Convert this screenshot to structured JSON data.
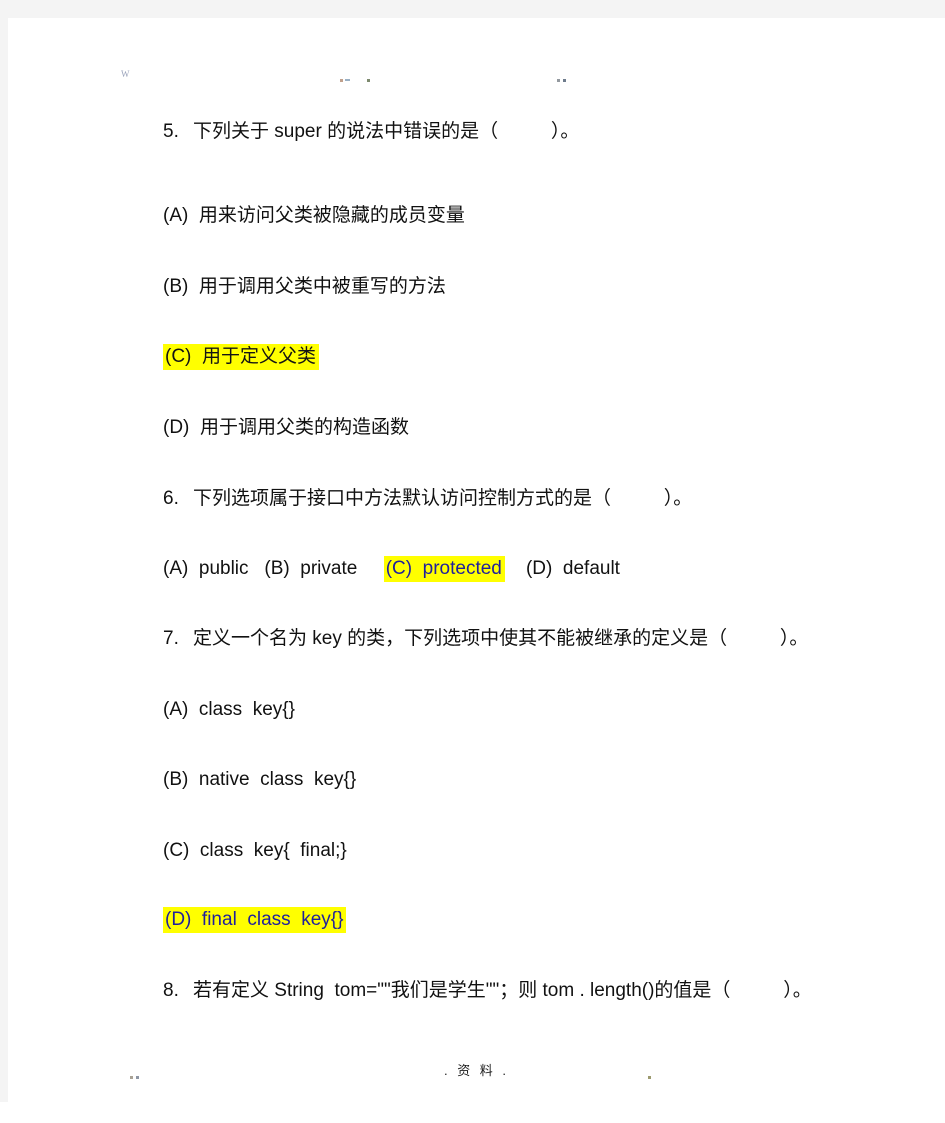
{
  "page": {
    "header": {
      "watermark_mark": "W"
    },
    "footer": {
      "center_text": ". 资 料 ."
    }
  },
  "colors": {
    "highlight": "#ffff00",
    "highlight_text": "#1f1f9e",
    "body_text": "#111111",
    "page_background": "#ffffff",
    "scan_gutter": "#f4f4f4"
  },
  "questions": [
    {
      "number": "5.",
      "stem": "下列关于 super 的说法中错误的是（          ）。",
      "options": [
        {
          "label": "(A)",
          "text": "用来访问父类被隐藏的成员变量",
          "highlighted": false
        },
        {
          "label": "(B)",
          "text": "用于调用父类中被重写的方法",
          "highlighted": false
        },
        {
          "label": "(C)",
          "text": "用于定义父类",
          "highlighted": true
        },
        {
          "label": "(D)",
          "text": "用于调用父类的构造函数",
          "highlighted": false
        }
      ]
    },
    {
      "number": "6.",
      "stem": "下列选项属于接口中方法默认访问控制方式的是（          ）。",
      "options": [
        {
          "label": "(A)",
          "text": "public",
          "highlighted": false
        },
        {
          "label": "(B)",
          "text": "private",
          "highlighted": false
        },
        {
          "label": "(C)",
          "text": "protected",
          "highlighted": true
        },
        {
          "label": "(D)",
          "text": "default",
          "highlighted": false
        }
      ],
      "inline_options": true
    },
    {
      "number": "7.",
      "stem": "定义一个名为 key 的类，下列选项中使其不能被继承的定义是（          ）。",
      "options": [
        {
          "label": "(A)",
          "text": "class  key{}",
          "highlighted": false
        },
        {
          "label": "(B)",
          "text": "native  class  key{}",
          "highlighted": false
        },
        {
          "label": "(C)",
          "text": "class  key{  final;}",
          "highlighted": false
        },
        {
          "label": "(D)",
          "text": "final  class  key{}",
          "highlighted": true
        }
      ]
    },
    {
      "number": "8.",
      "stem": "若有定义 String  tom=\"\"我们是学生\"\"；则 tom . length()的值是（          ）。",
      "options": []
    }
  ],
  "rendered_lines": {
    "q5_stem": {
      "num": "5.",
      "text": "下列关于 super 的说法中错误的是（          ）。"
    },
    "q5_a": {
      "label": "(A)",
      "text": "用来访问父类被隐藏的成员变量"
    },
    "q5_b": {
      "label": "(B)",
      "text": "用于调用父类中被重写的方法"
    },
    "q5_c": {
      "label": "(C)",
      "text": "用于定义父类"
    },
    "q5_d": {
      "label": "(D)",
      "text": "用于调用父类的构造函数"
    },
    "q6_stem": {
      "num": "6.",
      "text": "下列选项属于接口中方法默认访问控制方式的是（          ）。"
    },
    "q6_a": "(A)  public",
    "q6_b": "(B)  private",
    "q6_c": "(C)  protected",
    "q6_d": "(D)  default",
    "q7_stem": {
      "num": "7.",
      "text": "定义一个名为 key 的类，下列选项中使其不能被继承的定义是（          ）。"
    },
    "q7_a": "(A)  class  key{}",
    "q7_b": "(B)  native  class  key{}",
    "q7_c": "(C)  class  key{  final;}",
    "q7_d": "(D)  final  class  key{}",
    "q8_stem": {
      "num": "8.",
      "text": "若有定义 String  tom=\"\"我们是学生\"\"；则 tom . length()的值是（          ）。"
    }
  }
}
